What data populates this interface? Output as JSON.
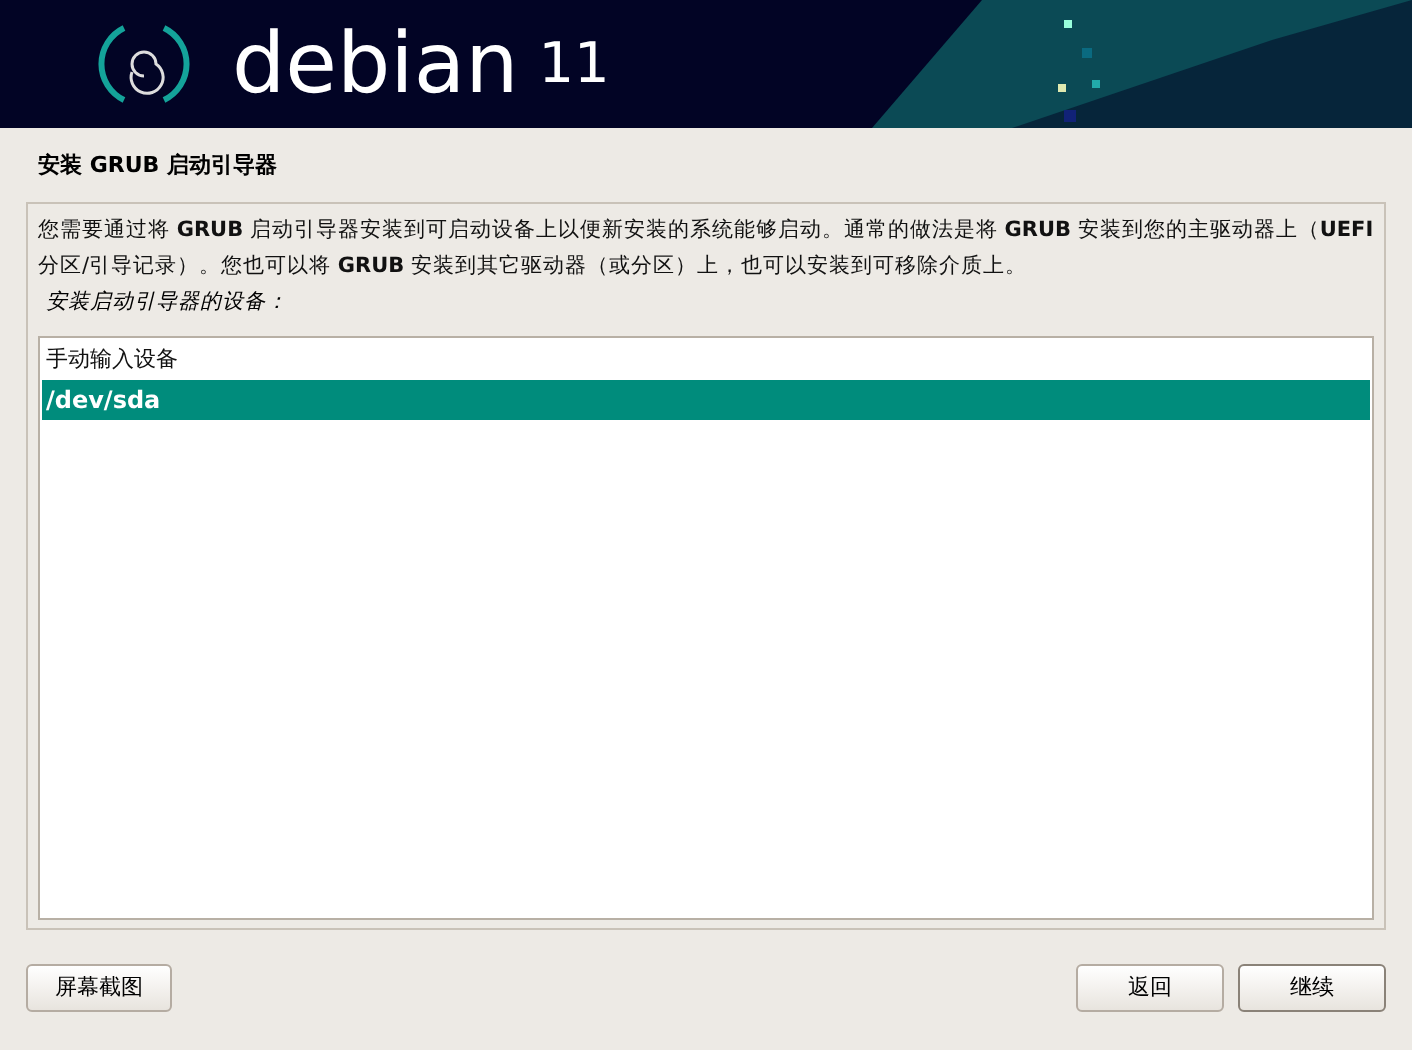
{
  "header": {
    "logo_text": "debian",
    "version": "11"
  },
  "title": "安装 GRUB 启动引导器",
  "description": "您需要通过将 **GRUB** 启动引导器安装到可启动设备上以便新安装的系统能够启动。通常的做法是将 **GRUB** 安装到您的主驱动器上（**UEFI** 分区/引导记录）。您也可以将 **GRUB** 安装到其它驱动器（或分区）上，也可以安装到可移除介质上。",
  "prompt": "安装启动引导器的设备：",
  "options": [
    {
      "label": "手动输入设备",
      "selected": false
    },
    {
      "label": "/dev/sda",
      "selected": true
    }
  ],
  "buttons": {
    "left": [
      "屏幕截图"
    ],
    "right": [
      "返回",
      "继续"
    ]
  }
}
